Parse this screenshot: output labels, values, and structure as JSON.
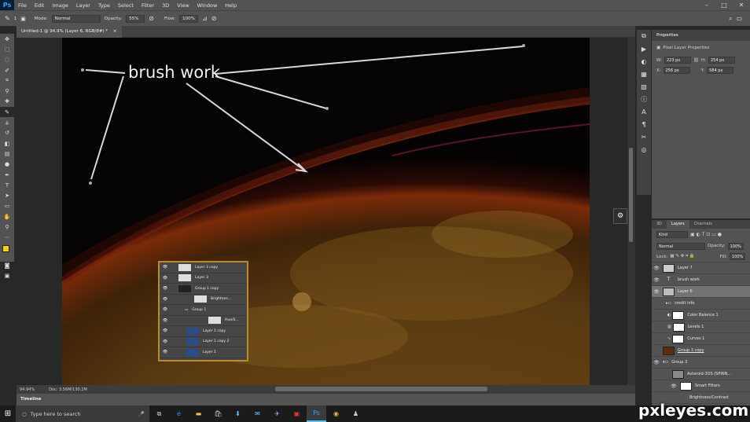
{
  "app": {
    "logo": "Ps"
  },
  "menu": [
    "File",
    "Edit",
    "Image",
    "Layer",
    "Type",
    "Select",
    "Filter",
    "3D",
    "View",
    "Window",
    "Help"
  ],
  "window_controls": [
    "–",
    "□",
    "✕"
  ],
  "options": {
    "brush_size": "1",
    "mode_label": "Mode:",
    "mode_value": "Normal",
    "opacity_label": "Opacity:",
    "opacity_value": "55%",
    "flow_label": "Flow:",
    "flow_value": "100%"
  },
  "document_tab": {
    "title": "Untitled-1 @ 94.9% (Layer 6, RGB/8#) *",
    "close": "×"
  },
  "canvas": {
    "annotation": "brush work"
  },
  "status": {
    "zoom": "94.94%",
    "doc": "Doc: 3.56M/130.2M"
  },
  "timeline": {
    "label": "Timeline"
  },
  "properties": {
    "tab": "Properties",
    "title": "Pixel Layer Properties",
    "w_label": "W:",
    "w": "223 px",
    "h_label": "H:",
    "h": "254 px",
    "x_label": "X:",
    "x": "256 px",
    "y_label": "Y:",
    "y": "584 px"
  },
  "layers_panel": {
    "tabs": [
      "3D",
      "Layers",
      "Channels"
    ],
    "kind": "Kind",
    "blend": "Normal",
    "opacity_label": "Opacity:",
    "opacity": "100%",
    "lock_label": "Lock:",
    "fill_label": "Fill:",
    "fill": "100%",
    "rows": [
      {
        "name": "Layer 7"
      },
      {
        "name": "brush work"
      },
      {
        "name": "Layer 6"
      },
      {
        "name": "credit info"
      },
      {
        "name": "Color Balance 1"
      },
      {
        "name": "Levels 1"
      },
      {
        "name": "Curves 1"
      },
      {
        "name": "Group 3 copy"
      },
      {
        "name": "Group 3"
      },
      {
        "name": "Asteroid-3DS (SPINN..."
      },
      {
        "name": "Smart Filters"
      },
      {
        "name": "Brightness/Contrast"
      }
    ]
  },
  "inner_screenshot": {
    "rows": [
      {
        "name": "Layer 3 copy"
      },
      {
        "name": "Layer 3"
      },
      {
        "name": "Group 1 copy"
      },
      {
        "name": "Brightnes..."
      },
      {
        "name": "Group 1"
      },
      {
        "name": "Hue/S..."
      },
      {
        "name": "Layer 1 copy"
      },
      {
        "name": "Layer 1 copy 2"
      },
      {
        "name": "Layer 1"
      }
    ]
  },
  "taskbar": {
    "search_placeholder": "Type here to search"
  },
  "watermark": "pxleyes.com",
  "colors": {
    "accent": "#31a8ff",
    "panel": "#535353",
    "highlight_border": "#b88a2a"
  }
}
